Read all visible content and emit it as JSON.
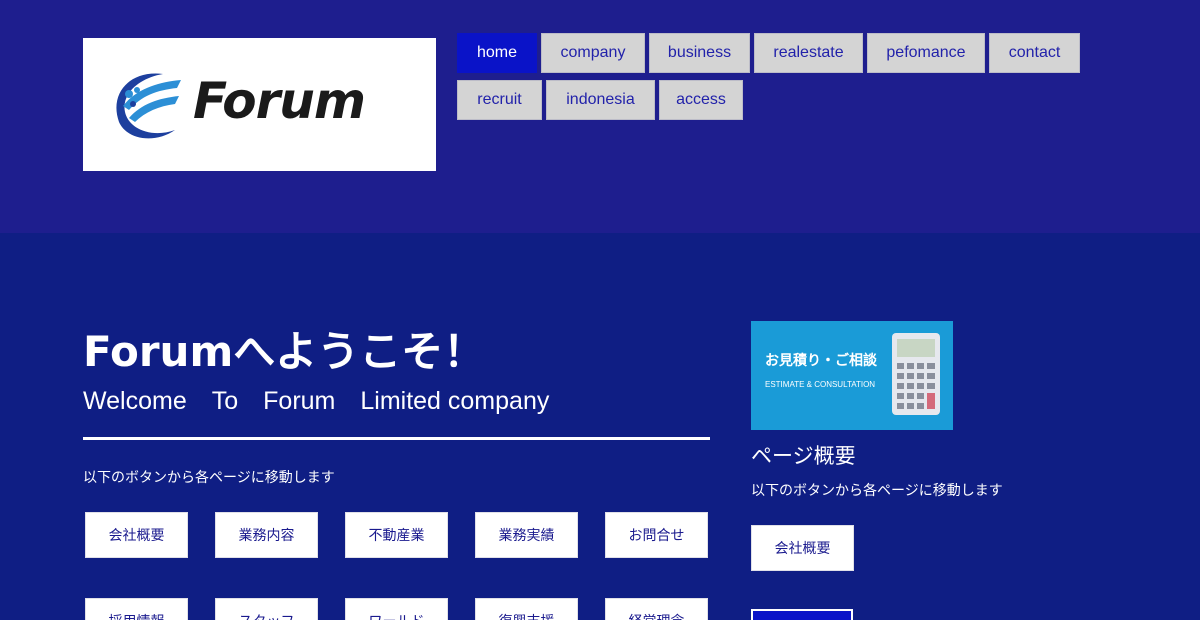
{
  "brand": {
    "logo_text": "Forum"
  },
  "nav": {
    "items": [
      {
        "label": "home",
        "active": true
      },
      {
        "label": "company"
      },
      {
        "label": "business"
      },
      {
        "label": "realestate"
      },
      {
        "label": "pefomance"
      },
      {
        "label": "contact"
      },
      {
        "label": "recruit"
      },
      {
        "label": "indonesia"
      },
      {
        "label": "access"
      }
    ]
  },
  "main": {
    "title": "Forumへようこそ！",
    "subtitle": "Welcome　To　Forum　Limited company",
    "intro": "以下のボタンから各ページに移動します",
    "buttons_row1": [
      "会社概要",
      "業務内容",
      "不動産業",
      "業務実績",
      "お問合せ"
    ],
    "buttons_row2": [
      "採用情報",
      "スタッフ",
      "ワールド",
      "復興支援",
      "経営理念"
    ]
  },
  "sidebar": {
    "banner_main": "お見積り・ご相談",
    "banner_sub": "ESTIMATE & CONSULTATION",
    "title": "ページ概要",
    "intro": "以下のボタンから各ページに移動します",
    "button1": "会社概要"
  },
  "colors": {
    "header_bg": "#1e1e8e",
    "body_bg": "#0f1e84",
    "nav_active": "#0a13c8",
    "nav_inactive": "#d4d4d4",
    "banner_bg": "#1a9bd7"
  }
}
